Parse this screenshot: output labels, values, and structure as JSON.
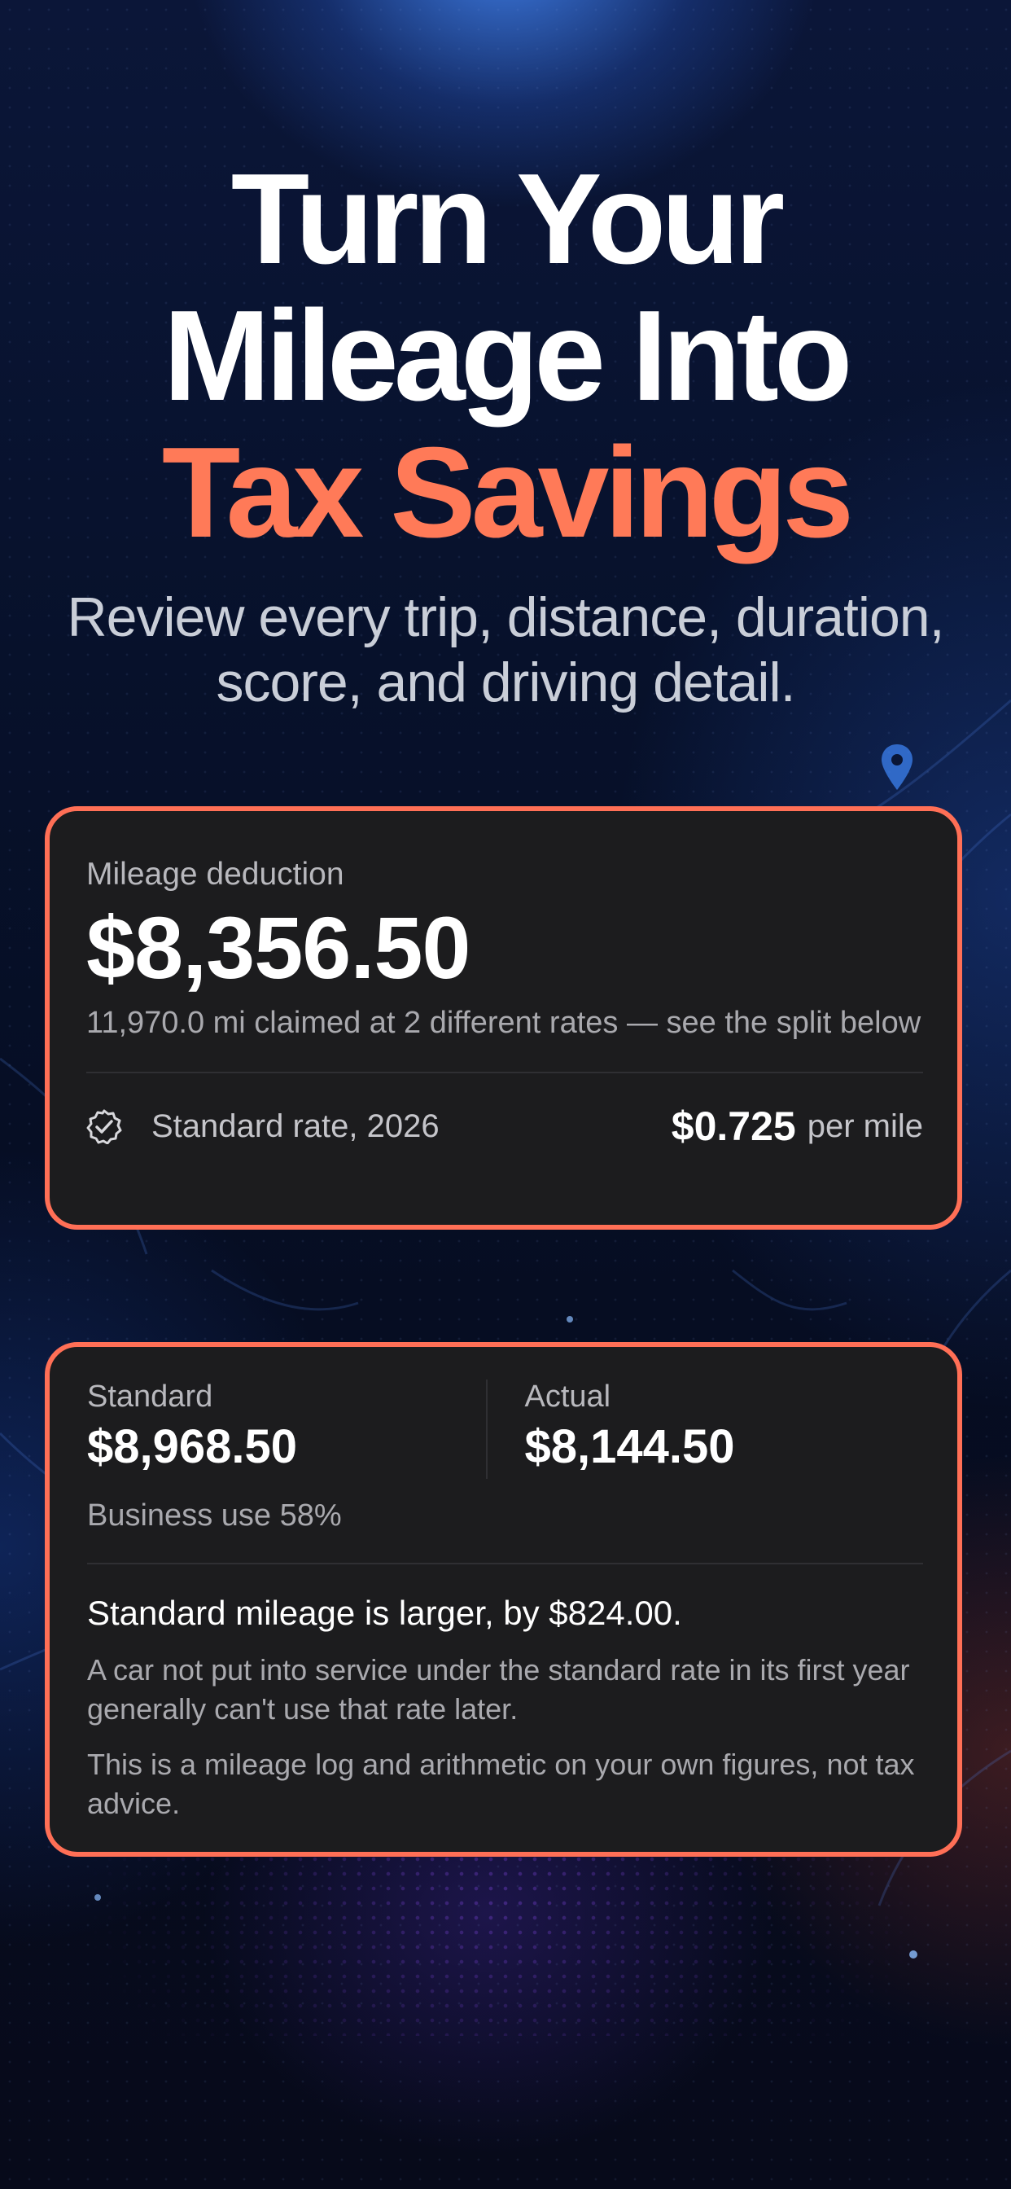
{
  "headline": {
    "line1": "Turn Your",
    "line2": "Mileage Into",
    "line3": "Tax Savings"
  },
  "subtitle": "Review every trip, distance, duration, score, and driving detail.",
  "deduction_card": {
    "label": "Mileage deduction",
    "amount": "$8,356.50",
    "description": "11,970.0 mi claimed at 2 different rates — see the split below",
    "rate_label": "Standard rate, 2026",
    "rate_value": "$0.725",
    "rate_unit": "per mile",
    "rate_icon": "verified-badge-icon"
  },
  "comparison_card": {
    "standard_label": "Standard",
    "standard_amount": "$8,968.50",
    "actual_label": "Actual",
    "actual_amount": "$8,144.50",
    "business_use": "Business use 58%",
    "conclusion": "Standard mileage is larger, by $824.00.",
    "note1": "A car not put into service under the standard rate in its first year generally can't use that rate later.",
    "note2": "This is a mileage log and arithmetic on your own figures, not tax advice."
  },
  "colors": {
    "accent": "#ff7a58",
    "card_border": "#ff6f56",
    "card_bg": "#1c1c1e",
    "background": "#07112b"
  },
  "decor": {
    "pin_icon": "map-pin-icon"
  }
}
